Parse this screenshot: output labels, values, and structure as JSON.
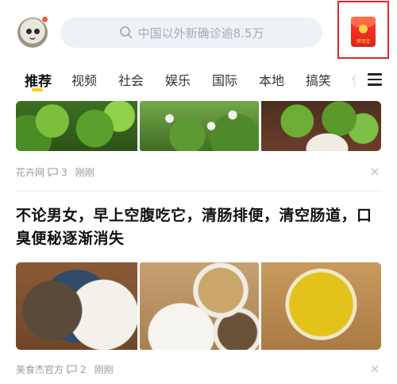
{
  "header": {
    "search_placeholder": "中国以外新确诊逾8.5万",
    "redpacket_label": "领现金"
  },
  "tabs": [
    {
      "label": "推荐",
      "active": true
    },
    {
      "label": "视频"
    },
    {
      "label": "社会"
    },
    {
      "label": "娱乐"
    },
    {
      "label": "国际"
    },
    {
      "label": "本地"
    },
    {
      "label": "搞笑"
    },
    {
      "label": "体"
    }
  ],
  "feed": [
    {
      "source": "花卉网",
      "comments": "3",
      "time": "刚刚"
    },
    {
      "title": "不论男女，早上空腹吃它，清肠排便，清空肠道，口臭便秘逐渐消失",
      "source": "美食杰官方",
      "comments": "2",
      "time": "刚刚"
    }
  ],
  "colors": {
    "accent": "#ffcc00",
    "highlight_box": "#e5242b",
    "meta_text": "#999999"
  }
}
